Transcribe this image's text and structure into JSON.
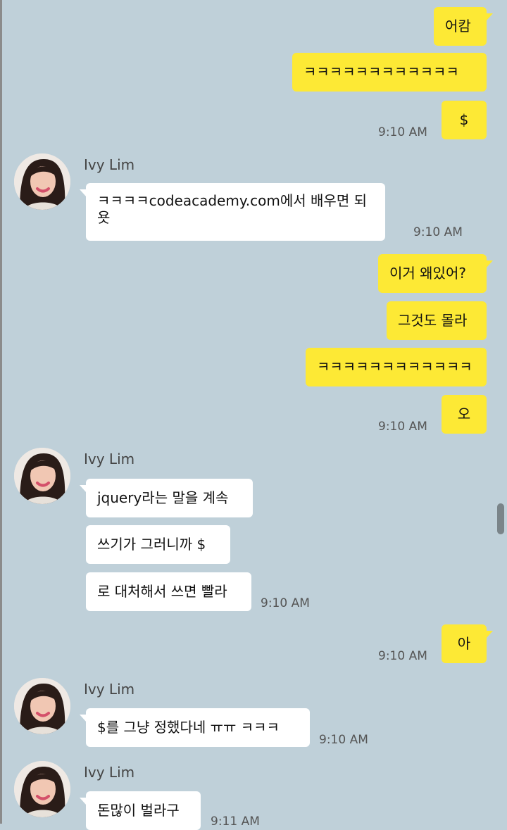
{
  "conversation": {
    "contact_name": "Ivy Lim",
    "messages": [
      {
        "side": "me",
        "text": "어캄"
      },
      {
        "side": "me",
        "text": "ㅋㅋㅋㅋㅋㅋㅋㅋㅋㅋㅋㅋ"
      },
      {
        "side": "me",
        "text": "$",
        "time": "9:10 AM"
      },
      {
        "side": "them",
        "sender": "Ivy Lim",
        "text": "ㅋㅋㅋㅋcodeacademy.com에서 배우면 되욧",
        "time": "9:10 AM"
      },
      {
        "side": "me",
        "text": "이거 왜있어?"
      },
      {
        "side": "me",
        "text": "그것도 몰라"
      },
      {
        "side": "me",
        "text": "ㅋㅋㅋㅋㅋㅋㅋㅋㅋㅋㅋㅋ"
      },
      {
        "side": "me",
        "text": "오",
        "time": "9:10 AM"
      },
      {
        "side": "them",
        "sender": "Ivy Lim",
        "text": "jquery라는 말을 계속"
      },
      {
        "side": "them",
        "text": "쓰기가 그러니까 $"
      },
      {
        "side": "them",
        "text": "로 대처해서 쓰면 빨라",
        "time": "9:10 AM"
      },
      {
        "side": "me",
        "text": "아",
        "time": "9:10 AM"
      },
      {
        "side": "them",
        "sender": "Ivy Lim",
        "text": "$를 그냥 정했다네 ㅠㅠ ㅋㅋㅋ",
        "time": "9:10 AM"
      },
      {
        "side": "them",
        "sender": "Ivy Lim",
        "text": "돈많이 벌라구",
        "time": "9:11 AM"
      }
    ]
  },
  "colors": {
    "background": "#bfd0d9",
    "my_bubble": "#fde935",
    "their_bubble": "#ffffff"
  },
  "icons": {
    "avatar": "profile-photo"
  }
}
